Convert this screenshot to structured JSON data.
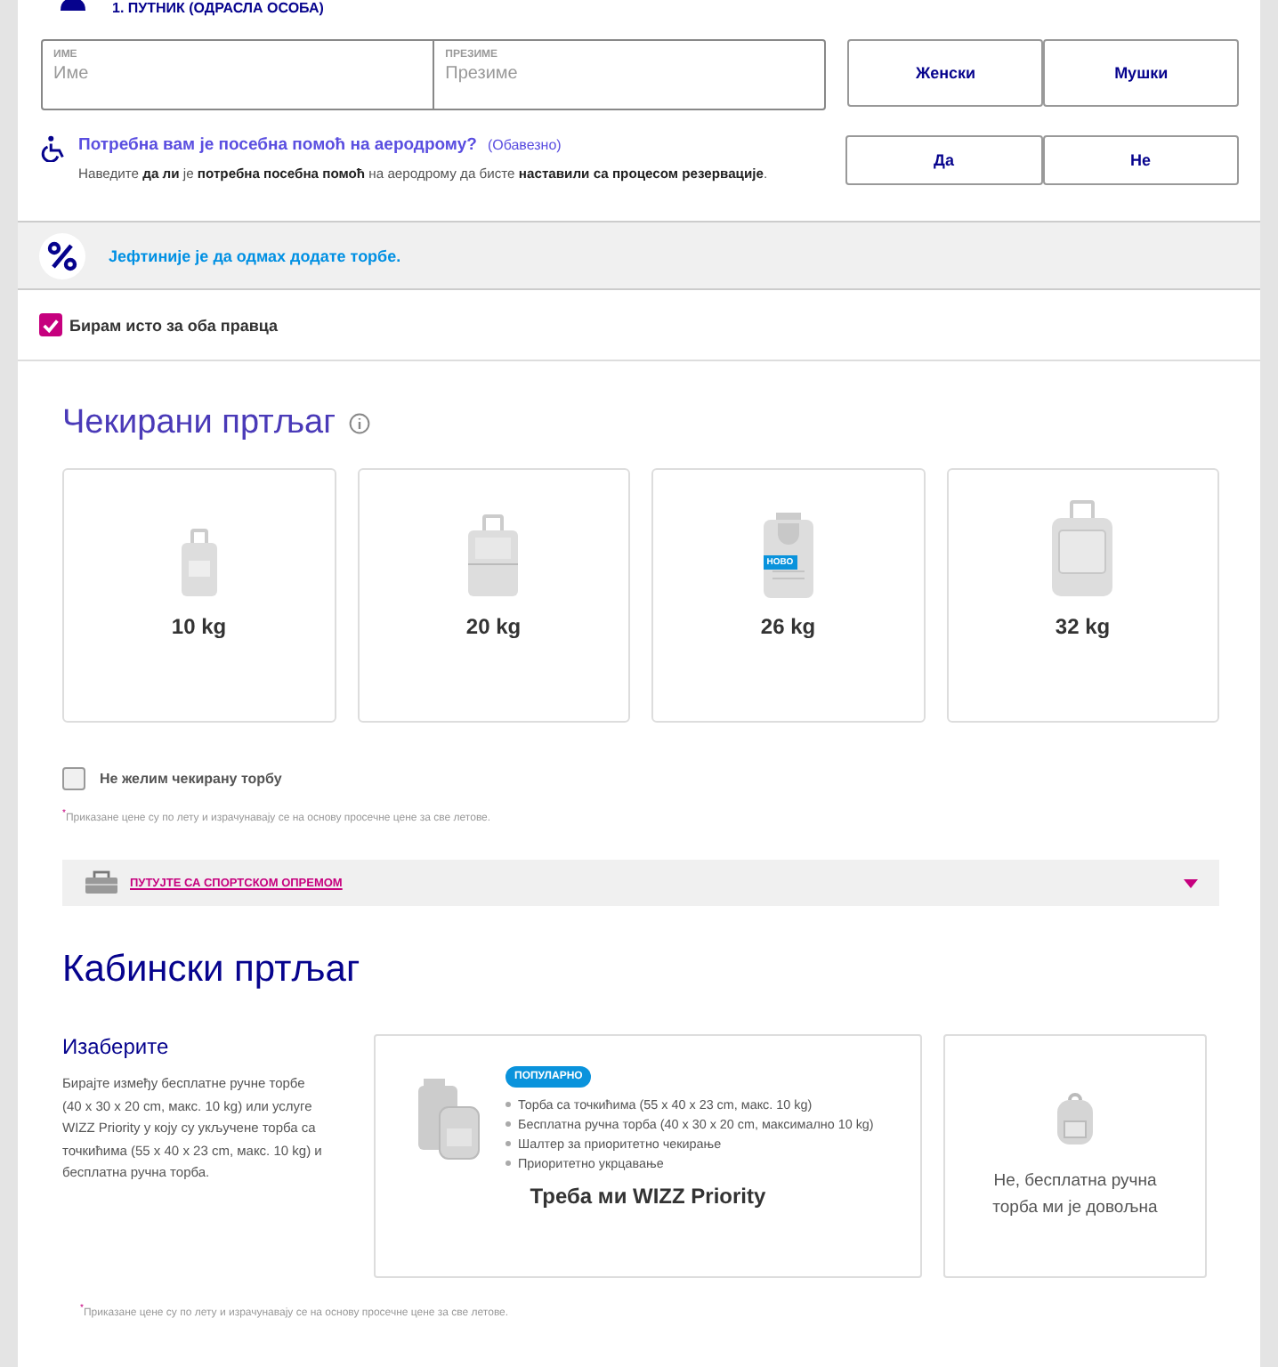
{
  "passenger": {
    "title": "1. ПУТНИК (ОДРАСЛА ОСОБА)",
    "fields": [
      {
        "label": "ИМЕ",
        "placeholder": "Име"
      },
      {
        "label": "ПРЕЗИМЕ",
        "placeholder": "Презиме"
      }
    ],
    "gender": [
      {
        "label": "Женски",
        "selected": false
      },
      {
        "label": "Мушки",
        "selected": false
      }
    ],
    "assistance": {
      "question": "Потребна вам је посебна помоћ на аеродрому?",
      "required": "(Обавезно)",
      "hint": "Наведите **да ли** је **потребна посебна помоћ** на аеродрому да бисте **наставили са процесом резервације**.",
      "options": [
        {
          "label": "Да",
          "selected": false
        },
        {
          "label": "Не",
          "selected": false
        }
      ]
    }
  },
  "promo": {
    "text": "Јефтиније је да одмах додате торбе."
  },
  "same_both_ways": {
    "label": "Бирам исто за оба правца",
    "checked": true
  },
  "checked_baggage": {
    "title": "Чекирани пртљаг",
    "options": [
      {
        "weight": "10 kg",
        "kind": "small"
      },
      {
        "weight": "20 kg",
        "kind": "medium"
      },
      {
        "weight": "26 kg",
        "kind": "new",
        "badge": "НОВО"
      },
      {
        "weight": "32 kg",
        "kind": "large"
      }
    ],
    "no_bag": {
      "label": "Не желим чекирану торбу",
      "checked": false
    },
    "footnote": "$^{*}$Приказане цене су по лету и израчунавају се на основу просечне цене за све летове.",
    "sports": {
      "label": "ПУТУЈТЕ СА СПОРТСКОМ ОПРЕМОМ",
      "expanded": false
    }
  },
  "cabin_baggage": {
    "title": "Кабински пртљаг",
    "subtitle": "Изаберите",
    "description": "Бирајте између бесплатне ручне торбе (40 x 30 x 20 cm, макс. 10 kg) или услуге WIZZ Priority у коју су укључене торба са точкићима (55 x 40 x 23 cm, макс. 10 kg) и бесплатна ручна торба.",
    "priority": {
      "badge": "ПОПУЛАРНО",
      "features": [
        "Торба са точкићима (55 x 40 x 23 cm, макс. 10 kg)",
        "Бесплатна ручна торба (40 x 30 x 20 cm, максимално 10 kg)",
        "Шалтер за приоритетно чекирање",
        "Приоритетно укрцавање"
      ],
      "title": "Треба ми WIZZ Priority"
    },
    "free": {
      "title": "Не, бесплатна ручна торба ми је довољна"
    },
    "footnote": "$^{*}$Приказане цене су по лету и израчунавају се на основу просечне цене за све летове."
  }
}
